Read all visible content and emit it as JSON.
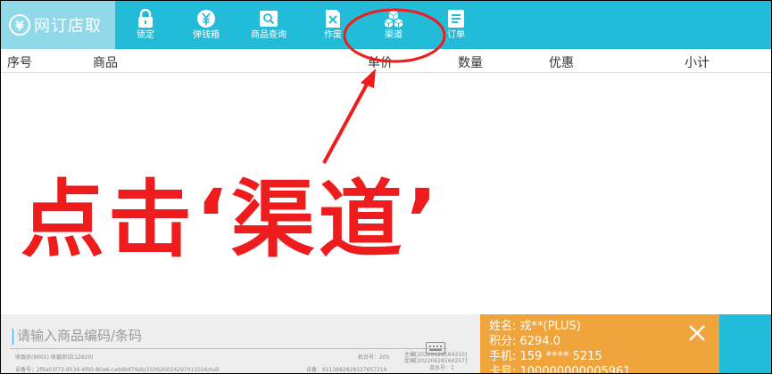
{
  "app": {
    "title": "网订店取"
  },
  "toolbar": {
    "items": [
      {
        "label": "锁定",
        "icon": "lock-icon"
      },
      {
        "label": "弹钱箱",
        "icon": "cash-drawer-icon"
      },
      {
        "label": "商品查询",
        "icon": "search-product-icon"
      },
      {
        "label": "作废",
        "icon": "void-icon"
      },
      {
        "label": "渠道",
        "icon": "channel-cubes-icon"
      },
      {
        "label": "订单",
        "icon": "order-list-icon"
      }
    ]
  },
  "table": {
    "headers": [
      "序号",
      "商品",
      "单价",
      "数量",
      "优惠",
      "小计"
    ]
  },
  "annotation": {
    "text": "点击‘渠道’",
    "color": "#ee1c1c"
  },
  "bottom": {
    "input_placeholder": "请输入商品编码/条码",
    "tiny": {
      "cashier": "收银员(9001)  收银测试(12620)",
      "machine": "机台号：205",
      "order_code1": "主编[20220628164310]",
      "order_code2": "促编[20220628164257]",
      "flow": "流水号：1",
      "device": "设备号：2f9a01f73-9534-4f00-80a6-ca66bd79ab/350020024297011016/null",
      "terminal": "设备：9213882828327657216"
    }
  },
  "member": {
    "name": "姓名: 戎**(PLUS)",
    "points": "积分: 6294.0",
    "phone": "手机: 159 **** 5215",
    "card": "卡号: 100000000005961"
  },
  "colors": {
    "toolbar": "#23bcd8",
    "brand": "#8fd9e8",
    "member": "#f0a43c",
    "annotation": "#ee1c1c"
  }
}
